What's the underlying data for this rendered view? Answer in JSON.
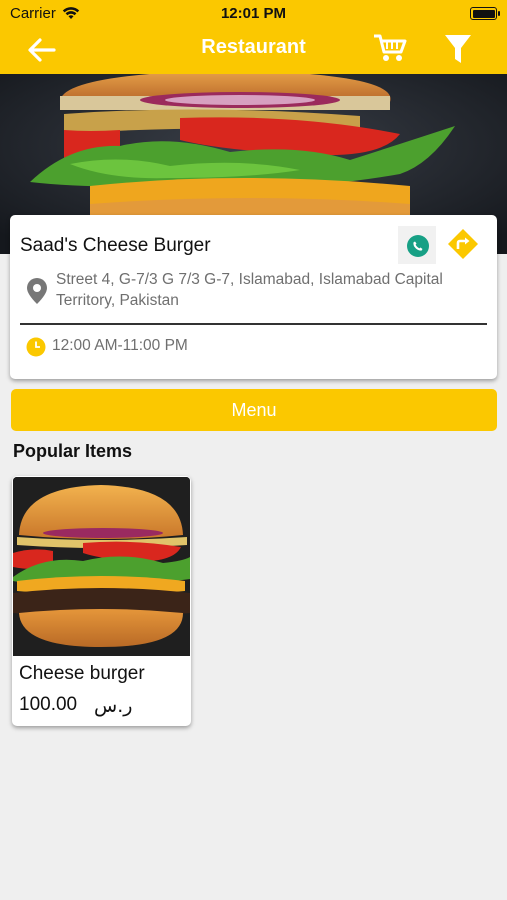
{
  "status_bar": {
    "carrier": "Carrier",
    "time": "12:01 PM"
  },
  "header": {
    "title": "Restaurant",
    "icons": [
      "back-arrow-icon",
      "cart-icon",
      "filter-icon"
    ]
  },
  "restaurant": {
    "name": "Saad's Cheese Burger",
    "address": "Street 4, G-7/3 G 7/3 G-7, Islamabad, Islamabad Capital Territory, Pakistan",
    "hours": "12:00 AM-11:00 PM"
  },
  "menu_button": {
    "label": "Menu"
  },
  "popular": {
    "title": "Popular Items",
    "items": [
      {
        "name": "Cheese burger",
        "price": "100.00",
        "currency": "ر.س"
      }
    ]
  },
  "colors": {
    "accent": "#fbc800",
    "call": "#17a085",
    "text_muted": "#6f6f6f",
    "background": "#efefef"
  }
}
